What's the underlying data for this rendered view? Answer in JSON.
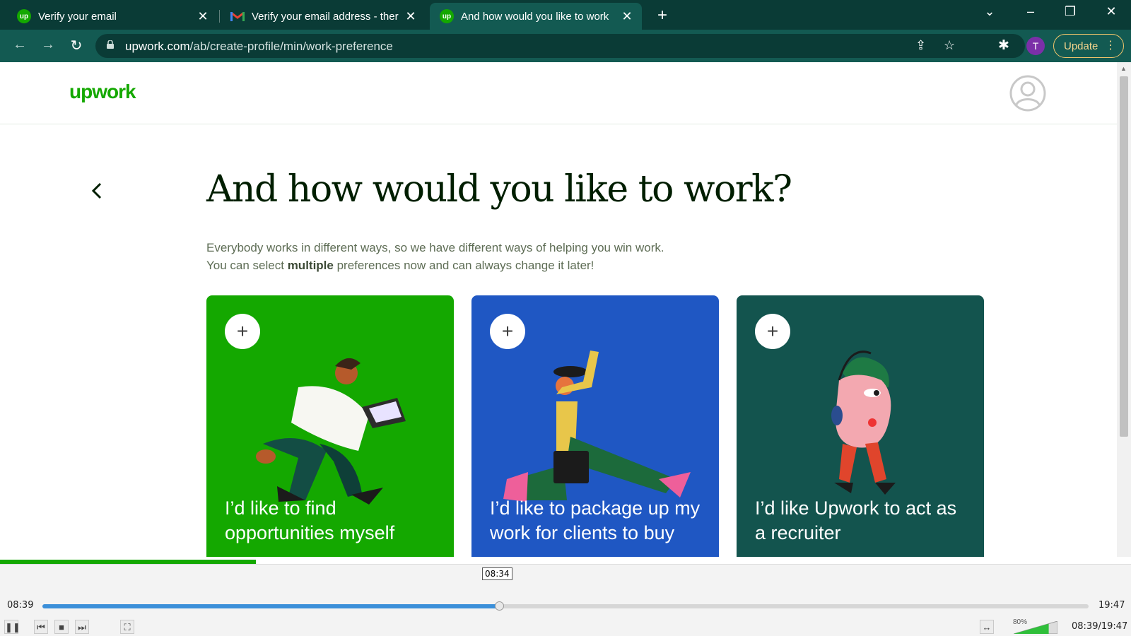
{
  "browser": {
    "tabs": [
      {
        "title": "Verify your email",
        "favicon": "upwork-icon",
        "active": false
      },
      {
        "title": "Verify your email address - there",
        "favicon": "gmail-icon",
        "active": false
      },
      {
        "title": "And how would you like to work",
        "favicon": "upwork-icon",
        "active": true
      }
    ],
    "favicon_text": "up",
    "new_tab": "+",
    "url_domain": "upwork.com",
    "url_path": "/ab/create-profile/min/work-preference",
    "profile_initial": "T",
    "update_label": "Update"
  },
  "page": {
    "logo": "upwork",
    "title": "And how would you like to work?",
    "subtitle_line1": "Everybody works in different ways, so we have different ways of helping you win work.",
    "subtitle_line2_pre": "You can select ",
    "subtitle_line2_bold": "multiple",
    "subtitle_line2_post": " preferences now and can always change it later!",
    "cards": [
      {
        "label": "I’d like to find opportunities myself",
        "color": "#14a800"
      },
      {
        "label": "I’d like to package up my work for clients to buy",
        "color": "#1f57c3"
      },
      {
        "label": "I’d like Upwork to act as a recruiter",
        "color": "#13544e"
      }
    ]
  },
  "player": {
    "hover_time": "08:34",
    "current_time": "08:39",
    "duration": "19:47",
    "position_fraction": 0.4367,
    "volume_percent": "80%",
    "volume_fraction": 0.8,
    "time_summary": "08:39/19:47",
    "colors": {
      "seek_fill": "#3b8fd9",
      "recording_bar": "#14a800"
    }
  }
}
